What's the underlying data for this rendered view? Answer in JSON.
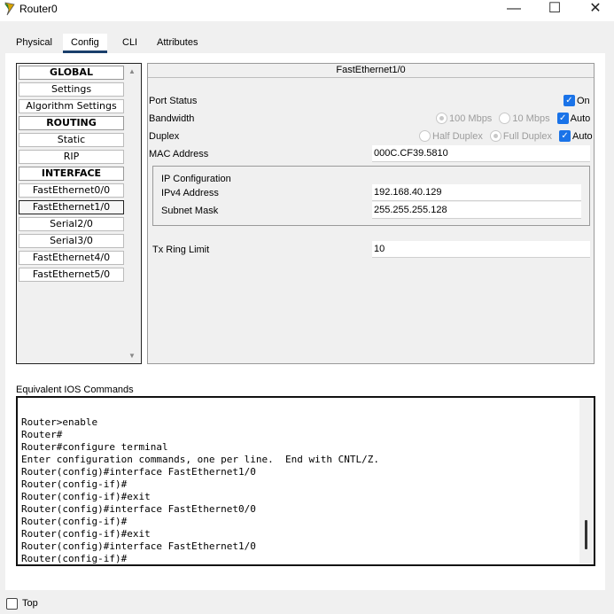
{
  "window": {
    "title": "Router0"
  },
  "tabs": [
    {
      "label": "Physical"
    },
    {
      "label": "Config"
    },
    {
      "label": "CLI"
    },
    {
      "label": "Attributes"
    }
  ],
  "sidebar": {
    "items": [
      {
        "label": "GLOBAL"
      },
      {
        "label": "Settings"
      },
      {
        "label": "Algorithm Settings"
      },
      {
        "label": "ROUTING"
      },
      {
        "label": "Static"
      },
      {
        "label": "RIP"
      },
      {
        "label": "INTERFACE"
      },
      {
        "label": "FastEthernet0/0"
      },
      {
        "label": "FastEthernet1/0"
      },
      {
        "label": "Serial2/0"
      },
      {
        "label": "Serial3/0"
      },
      {
        "label": "FastEthernet4/0"
      },
      {
        "label": "FastEthernet5/0"
      }
    ],
    "selected": "FastEthernet1/0"
  },
  "interface": {
    "title": "FastEthernet1/0",
    "port_status_label": "Port Status",
    "port_status_on_label": "On",
    "bandwidth_label": "Bandwidth",
    "bandwidth_100": "100 Mbps",
    "bandwidth_10": "10 Mbps",
    "bandwidth_auto": "Auto",
    "duplex_label": "Duplex",
    "duplex_half": "Half Duplex",
    "duplex_full": "Full Duplex",
    "duplex_auto": "Auto",
    "mac_label": "MAC Address",
    "mac_value": "000C.CF39.5810",
    "ip_config_title": "IP Configuration",
    "ipv4_label": "IPv4 Address",
    "ipv4_value": "192.168.40.129",
    "subnet_label": "Subnet Mask",
    "subnet_value": "255.255.255.128",
    "tx_ring_label": "Tx Ring Limit",
    "tx_ring_value": "10"
  },
  "ios": {
    "label": "Equivalent IOS Commands",
    "lines": [
      "Router>enable",
      "Router#",
      "Router#configure terminal",
      "Enter configuration commands, one per line.  End with CNTL/Z.",
      "Router(config)#interface FastEthernet1/0",
      "Router(config-if)#",
      "Router(config-if)#exit",
      "Router(config)#interface FastEthernet0/0",
      "Router(config-if)#",
      "Router(config-if)#exit",
      "Router(config)#interface FastEthernet1/0",
      "Router(config-if)#"
    ]
  },
  "footer": {
    "top_label": "Top"
  },
  "colors": {
    "accent": "#1a73e8",
    "tab_underline": "#1a3f6b"
  }
}
